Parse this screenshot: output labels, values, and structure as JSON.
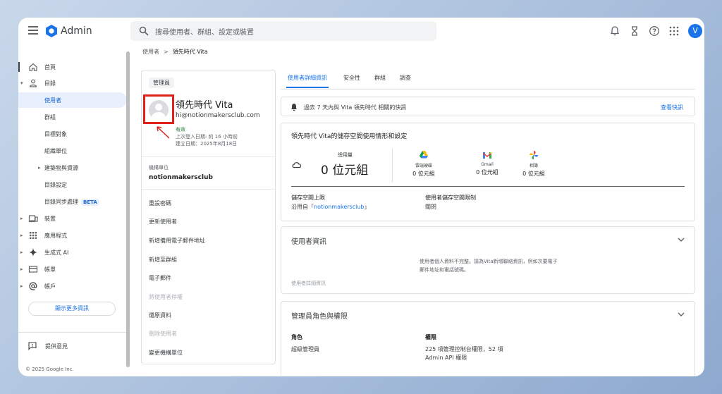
{
  "app": {
    "title": "Admin"
  },
  "search": {
    "placeholder": "搜尋使用者、群組、設定或裝置"
  },
  "user_avatar_letter": "V",
  "breadcrumb": {
    "parent": "使用者",
    "separator": ">",
    "current": "領先時代 Vita"
  },
  "sidebar": {
    "items": [
      {
        "label": "首頁"
      },
      {
        "label": "目錄"
      },
      {
        "label": "使用者"
      },
      {
        "label": "群組"
      },
      {
        "label": "目標對象"
      },
      {
        "label": "組織單位"
      },
      {
        "label": "建築物與資源"
      },
      {
        "label": "目錄設定"
      },
      {
        "label": "目錄同步處理",
        "badge": "BETA"
      },
      {
        "label": "裝置"
      },
      {
        "label": "應用程式"
      },
      {
        "label": "生成式 AI"
      },
      {
        "label": "帳單"
      },
      {
        "label": "帳戶"
      }
    ],
    "show_more": "顯示更多資訊",
    "feedback": "提供意見",
    "copyright": "© 2025 Google Inc."
  },
  "profile": {
    "role_chip": "管理員",
    "name": "領先時代 Vita",
    "email": "hi@notionmakersclub.com",
    "status": "有效",
    "last_login": "上次登入日期: 約 16 小時前",
    "created": "建立日期：2025年8月18日",
    "org_label": "機構單位",
    "org_value": "notionmakersclub",
    "actions": [
      {
        "label": "重設密碼",
        "enabled": true
      },
      {
        "label": "更新使用者",
        "enabled": true
      },
      {
        "label": "新增備用電子郵件地址",
        "enabled": true
      },
      {
        "label": "新增至群組",
        "enabled": true
      },
      {
        "label": "電子郵件",
        "enabled": true
      },
      {
        "label": "將使用者停權",
        "enabled": false
      },
      {
        "label": "還原資料",
        "enabled": true
      },
      {
        "label": "刪除使用者",
        "enabled": false
      },
      {
        "label": "變更機構單位",
        "enabled": true
      }
    ]
  },
  "tabs": [
    {
      "label": "使用者詳細資訊",
      "active": true
    },
    {
      "label": "安全性",
      "active": false
    },
    {
      "label": "群組",
      "active": false
    },
    {
      "label": "調查",
      "active": false
    }
  ],
  "notice": {
    "text": "過去 7 天內與 Vita 領先時代 相關的快訊",
    "link": "查看快訊"
  },
  "storage": {
    "title": "領先時代 Vita的儲存空間使用情形和設定",
    "used_label": "總用量",
    "used_value": "0 位元組",
    "services": [
      {
        "name": "雲端硬碟",
        "value": "0 位元組",
        "icon": "drive-icon"
      },
      {
        "name": "Gmail",
        "value": "0 位元組",
        "icon": "gmail-icon"
      },
      {
        "name": "相簿",
        "value": "0 位元組",
        "icon": "photos-icon"
      }
    ],
    "limit_label": "儲存空間上限",
    "limit_value_prefix": "沿用自「",
    "limit_value_link": "notionmakersclub",
    "limit_value_suffix": "」",
    "user_limit_label": "使用者儲存空間限制",
    "user_limit_value": "關閉"
  },
  "user_info": {
    "title": "使用者資訊",
    "message": "使用者個人資料不完整。請為Vita新增聯絡資訊，例如次要電子郵件地址和電話號碼。",
    "footer": "使用者詳細資訊"
  },
  "roles": {
    "title": "管理員角色與權限",
    "col_role": "角色",
    "col_perm": "權限",
    "role_value": "超級管理員",
    "perm_value": "225 項管理控制台權限，52 項 Admin API 權限"
  },
  "colors": {
    "accent": "#1a73e8",
    "highlight_box": "#e0201b",
    "status_green": "#188038"
  }
}
